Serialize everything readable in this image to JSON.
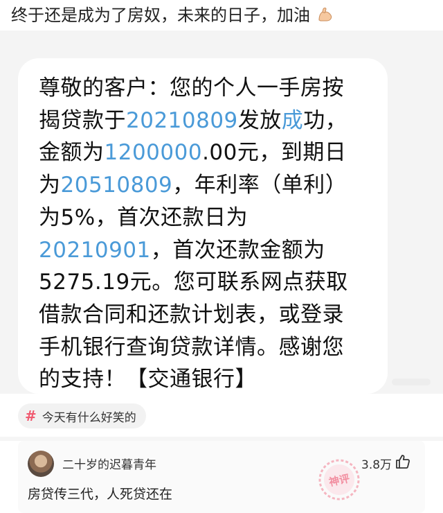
{
  "post": {
    "title": "终于还是成为了房奴，未来的日子，加油",
    "title_icon": "flexed-biceps-icon"
  },
  "sms": {
    "lines": [
      [
        {
          "t": "尊敬的客户：您的个人一手房按"
        }
      ],
      [
        {
          "t": "揭贷款于"
        },
        {
          "t": "20210809",
          "link": true
        },
        {
          "t": "发放"
        },
        {
          "t": "成",
          "link": true
        },
        {
          "t": "功，"
        }
      ],
      [
        {
          "t": "金额为"
        },
        {
          "t": "1200000",
          "link": true
        },
        {
          "t": ".00元，到期日"
        }
      ],
      [
        {
          "t": "为"
        },
        {
          "t": "20510809",
          "link": true
        },
        {
          "t": "，年利率（单利）"
        }
      ],
      [
        {
          "t": "为5%，首次还款日为"
        }
      ],
      [
        {
          "t": "20210901",
          "link": true
        },
        {
          "t": "，首次还款金额为"
        }
      ],
      [
        {
          "t": "5275.19元。您可联系网点获取"
        }
      ],
      [
        {
          "t": "借款合同和还款计划表，或登录"
        }
      ],
      [
        {
          "t": "手机银行查询贷款详情。感谢您"
        }
      ],
      [
        {
          "t": "的支持！【交通银行】"
        }
      ]
    ],
    "link_color": "#4a9ad8"
  },
  "topic": {
    "icon": "hash-icon",
    "hash": "#",
    "label": "今天有什么好笑的"
  },
  "comment": {
    "username": "二十岁的迟暮青年",
    "likes": "3.8万",
    "text": "房贷传三代，人死贷还在",
    "stamp": "神评"
  },
  "colors": {
    "accent_pink": "#f0596f",
    "link_blue": "#4a9ad8"
  }
}
